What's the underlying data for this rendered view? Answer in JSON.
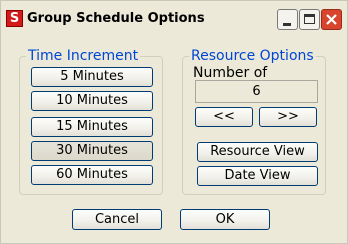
{
  "window": {
    "title": "Group Schedule Options",
    "app_icon_letter": "S",
    "title_buttons": [
      "minimize",
      "maximize",
      "close"
    ]
  },
  "time_increment": {
    "legend": "Time Increment",
    "options": [
      {
        "label": "5 Minutes"
      },
      {
        "label": "10 Minutes"
      },
      {
        "label": "15 Minutes"
      },
      {
        "label": "30 Minutes",
        "selected": true
      },
      {
        "label": "60 Minutes"
      }
    ]
  },
  "resource_options": {
    "legend": "Resource Options",
    "number_of_label": "Number of",
    "number_value": "6",
    "prev_label": "<<",
    "next_label": ">>",
    "resource_view_label": "Resource View",
    "date_view_label": "Date View"
  },
  "footer": {
    "cancel_label": "Cancel",
    "ok_label": "OK"
  },
  "colors": {
    "legend": "#0046d5",
    "button_border": "#003c74",
    "face": "#ece9d8"
  }
}
